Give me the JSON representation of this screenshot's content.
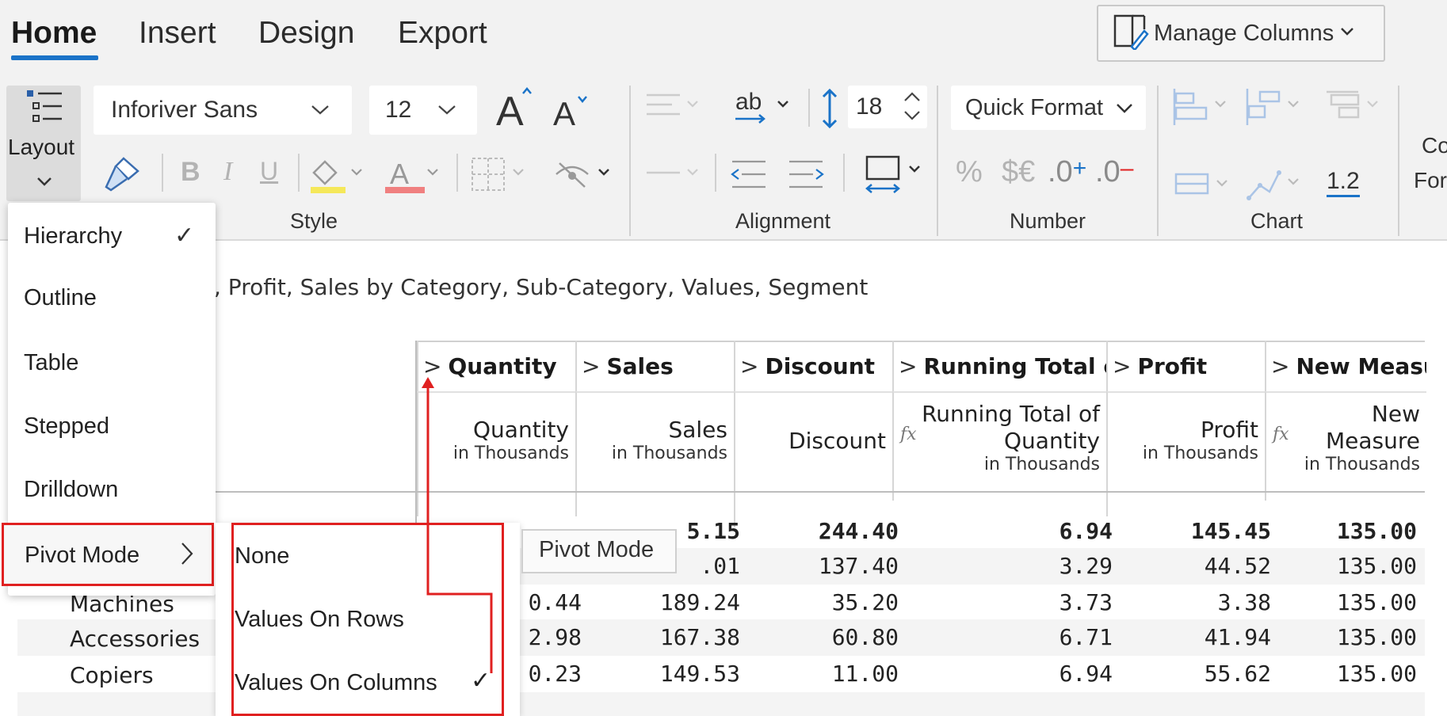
{
  "tabs": [
    {
      "label": "Home",
      "active": true
    },
    {
      "label": "Insert",
      "active": false
    },
    {
      "label": "Design",
      "active": false
    },
    {
      "label": "Export",
      "active": false
    }
  ],
  "manage_columns": {
    "label": "Manage Columns"
  },
  "ribbon": {
    "layout_label": "Layout",
    "font_family": "Inforiver Sans",
    "font_size": "12",
    "line_height": "18",
    "quick_format": "Quick Format",
    "decimal_value": "1.2",
    "text_wrap": "ab",
    "number_symbols": {
      "percent": "%",
      "currency": "$€",
      "inc_decimal": ".0",
      "dec_decimal": ".0"
    },
    "cut_off": {
      "line1": "Co",
      "line2": "For"
    },
    "groups": {
      "style": "Style",
      "alignment": "Alignment",
      "number": "Number",
      "chart": "Chart"
    }
  },
  "filter_text": ", Profit, Sales by Category, Sub-Category, Values, Segment",
  "table": {
    "headers": [
      "Quantity",
      "Sales",
      "Discount",
      "Running Total of",
      "Profit",
      "New Measu"
    ],
    "subheaders": [
      {
        "main": [
          "Quantity"
        ],
        "unit": "in Thousands",
        "fx": false
      },
      {
        "main": [
          "Sales"
        ],
        "unit": "in Thousands",
        "fx": false
      },
      {
        "main": [
          "Discount"
        ],
        "unit": "",
        "fx": false
      },
      {
        "main": [
          "Running Total of",
          "Quantity"
        ],
        "unit": "in Thousands",
        "fx": true
      },
      {
        "main": [
          "Profit"
        ],
        "unit": "in Thousands",
        "fx": false
      },
      {
        "main": [
          "New",
          "Measure"
        ],
        "unit": "in Thousands",
        "fx": true
      }
    ],
    "rows": [
      {
        "label": "",
        "values": [
          "",
          "5.15",
          "244.40",
          "6.94",
          "145.45",
          "135.00"
        ],
        "bold": true
      },
      {
        "label": "",
        "values": [
          "",
          ".01",
          "137.40",
          "3.29",
          "44.52",
          "135.00"
        ],
        "bold": false
      },
      {
        "label": "Machines",
        "values": [
          "0.44",
          "189.24",
          "35.20",
          "3.73",
          "3.38",
          "135.00"
        ],
        "bold": false
      },
      {
        "label": "Accessories",
        "values": [
          "2.98",
          "167.38",
          "60.80",
          "6.71",
          "41.94",
          "135.00"
        ],
        "bold": false
      },
      {
        "label": "Copiers",
        "values": [
          "0.23",
          "149.53",
          "11.00",
          "6.94",
          "55.62",
          "135.00"
        ],
        "bold": false
      }
    ]
  },
  "layout_menu": {
    "items": [
      {
        "label": "Hierarchy",
        "checked": true
      },
      {
        "label": "Outline",
        "checked": false
      },
      {
        "label": "Table",
        "checked": false
      },
      {
        "label": "Stepped",
        "checked": false
      },
      {
        "label": "Drilldown",
        "checked": false
      },
      {
        "label": "Pivot Mode",
        "checked": false,
        "submenu": true
      }
    ]
  },
  "pivot_submenu": {
    "items": [
      {
        "label": "None",
        "checked": false
      },
      {
        "label": "Values On Rows",
        "checked": false
      },
      {
        "label": "Values On Columns",
        "checked": true
      }
    ]
  },
  "tooltip": "Pivot Mode",
  "colors": {
    "accent": "#1a73c8",
    "highlight": "#e02020",
    "fill_swatch": "#f5e85a",
    "font_swatch": "#f08080"
  }
}
